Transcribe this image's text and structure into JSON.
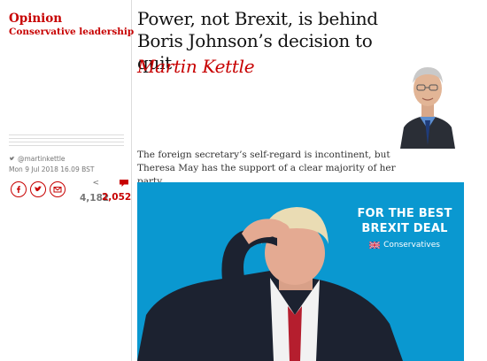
{
  "kicker": {
    "section": "Opinion",
    "series": "Conservative leadership"
  },
  "article": {
    "headline": "Power, not Brexit, is behind Boris Johnson’s decision to quit",
    "byline": "Martin Kettle",
    "standfirst": "The foreign secretary’s self-regard is incontinent, but Theresa May has the support of a clear majority of her party"
  },
  "meta": {
    "twitter_handle": "@martinkettle",
    "dateline": "Mon 9 Jul 2018 16.09 BST",
    "share_count": "4,182",
    "comment_count": "2,052"
  },
  "image": {
    "banner_line1": "FOR THE BEST",
    "banner_line2": "BREXIT DEAL",
    "banner_brand": "Conservatives"
  },
  "colors": {
    "accent": "#c70000",
    "backdrop": "#0a98d0"
  },
  "icons": [
    "twitter-icon",
    "facebook-icon",
    "twitter-share-icon",
    "email-icon",
    "share-arrow-icon",
    "comment-icon",
    "union-flag-icon"
  ]
}
